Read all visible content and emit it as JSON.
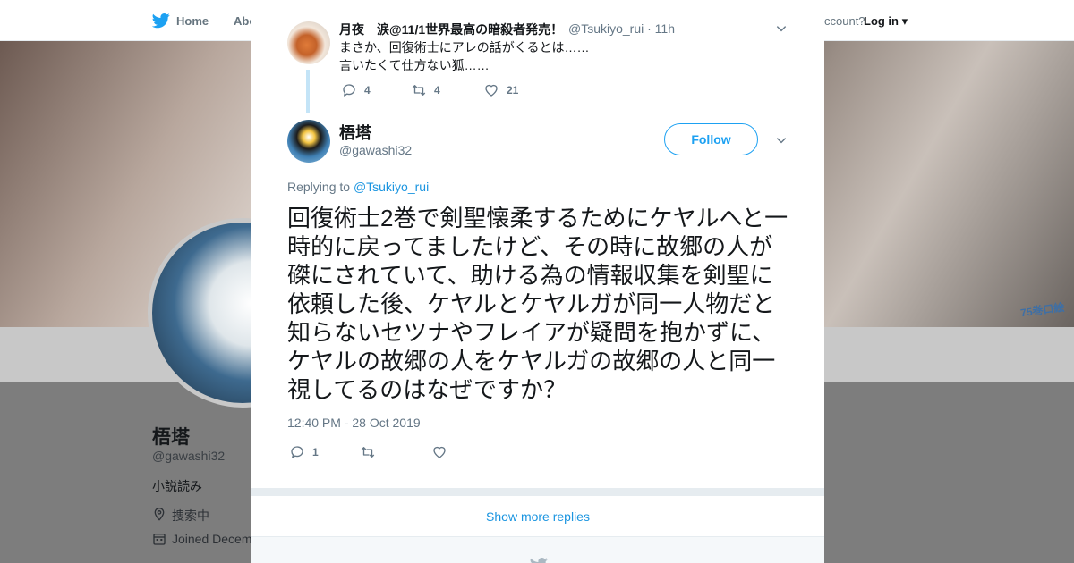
{
  "nav": {
    "home_label": "Home",
    "about_label": "Abo",
    "account_prompt": "ccount?",
    "login_label": "Log in"
  },
  "banner": {
    "sticker_text": "75巻口絵"
  },
  "profile": {
    "name": "梧塔",
    "handle": "@gawashi32",
    "bio": "小説読み",
    "location": "捜索中",
    "joined": "Joined Decem"
  },
  "parent_tweet": {
    "author_name": "月夜　涙@11/1世界最高の暗殺者発売！",
    "author_handle": "@Tsukiyo_rui · 11h",
    "text_line1": "まさか、回復術士にアレの話がくるとは……",
    "text_line2": "言いたくて仕方ない狐……",
    "reply_count": "4",
    "retweet_count": "4",
    "like_count": "21"
  },
  "main_tweet": {
    "author_name": "梧塔",
    "author_handle": "@gawashi32",
    "follow_label": "Follow",
    "replying_to_prefix": "Replying to",
    "replying_to_handle": "@Tsukiyo_rui",
    "text": "回復術士2巻で剣聖懐柔するためにケヤルへと一時的に戻ってましたけど、その時に故郷の人が磔にされていて、助ける為の情報収集を剣聖に依頼した後、ケヤルとケヤルガが同一人物だと知らないセツナやフレイアが疑問を抱かずに、ケヤルの故郷の人をケヤルガの故郷の人と同一視してるのはなぜですか？",
    "timestamp": "12:40 PM - 28 Oct 2019",
    "reply_count": "1",
    "retweet_count": "",
    "like_count": ""
  },
  "show_more_replies_label": "Show more replies",
  "colors": {
    "accent": "#1da1f2",
    "link": "#1b95e0",
    "thread_line": "#c4e4f7",
    "muted": "#657786"
  },
  "icons": [
    "twitter-bird-icon",
    "close-icon",
    "chevron-down-icon",
    "reply-icon",
    "retweet-icon",
    "like-icon",
    "location-icon",
    "calendar-icon"
  ]
}
